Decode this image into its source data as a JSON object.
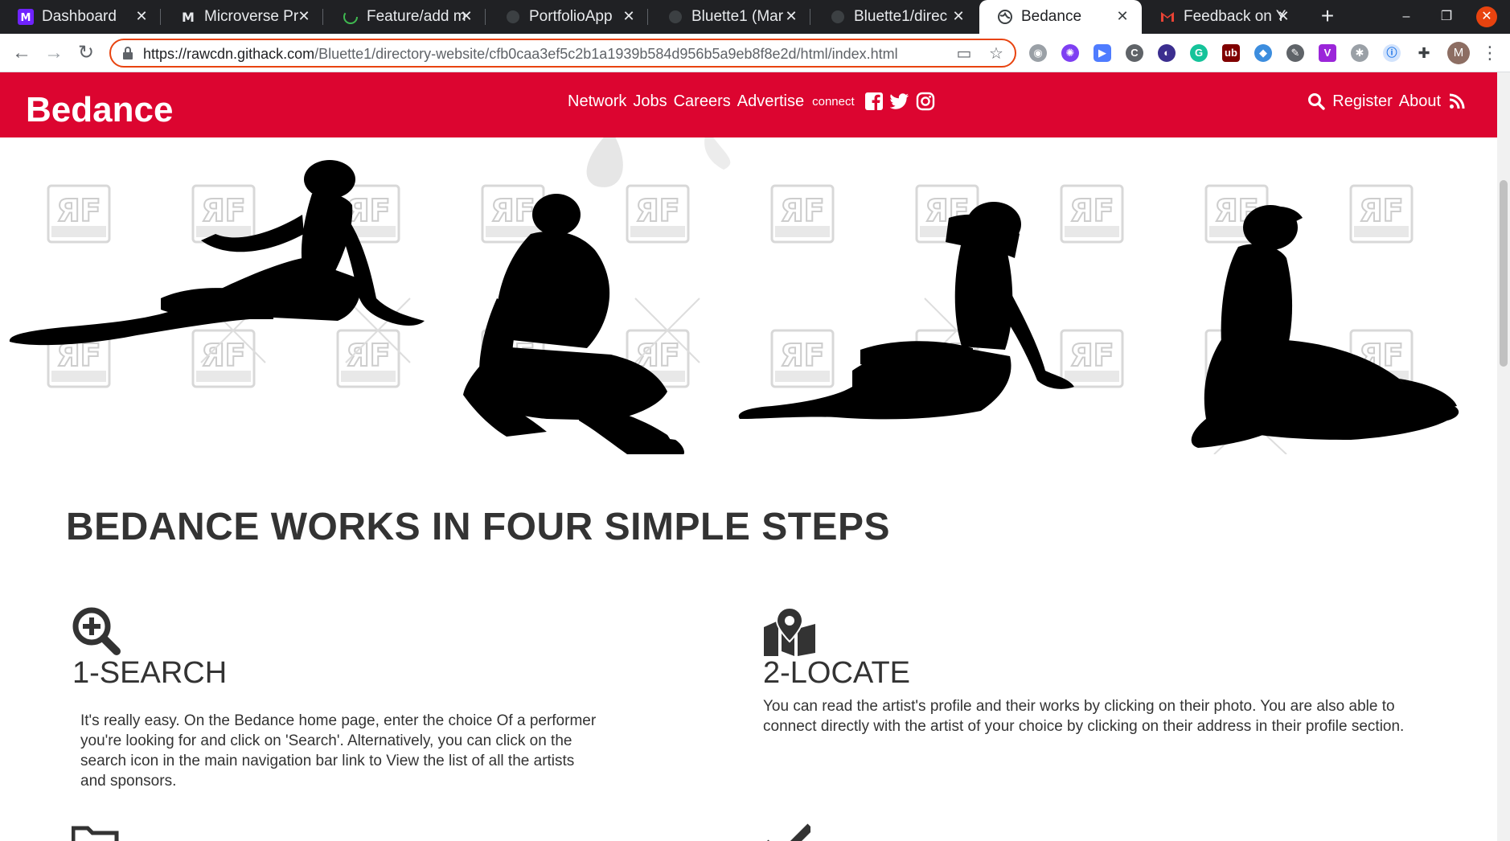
{
  "browser": {
    "tabs": [
      {
        "title": "Dashboard",
        "icon": "microverse-icon"
      },
      {
        "title": "Microverse Pr",
        "icon": "microverse-icon"
      },
      {
        "title": "Feature/add m",
        "icon": "github-icon"
      },
      {
        "title": "PortfolioApp",
        "icon": "globe-icon"
      },
      {
        "title": "Bluette1 (Mar",
        "icon": "github-icon"
      },
      {
        "title": "Bluette1/direc",
        "icon": "github-icon"
      },
      {
        "title": "Bedance",
        "icon": "globe-icon"
      },
      {
        "title": "Feedback on Y",
        "icon": "gmail-icon"
      }
    ],
    "url_host": "https://rawcdn.githack.com",
    "url_path": "/Bluette1/directory-website/cfb0caa3ef5c2b1a1939b584d956b5a9eb8f8e2d/html/index.html",
    "profile_initial": "M",
    "accent_color": "#e8430f"
  },
  "site": {
    "brand": "Bedance",
    "nav_center": [
      "Network",
      "Jobs",
      "Careers",
      "Advertise"
    ],
    "connect_label": "connect",
    "nav_right": [
      "Register",
      "About"
    ],
    "header_color": "#dc0530"
  },
  "main": {
    "heading": "BEDANCE WORKS IN FOUR SIMPLE STEPS",
    "steps": [
      {
        "title": "1-SEARCH",
        "icon": "search-plus-icon",
        "text": "It's really easy. On the Bedance home page, enter the choice Of a performer you're looking for and click on 'Search'. Alternatively, you can click on the search icon in the main navigation bar link to View the list of all the artists and sponsors."
      },
      {
        "title": "2-LOCATE",
        "icon": "map-marker-icon",
        "text": "You can read the artist's profile and their works by clicking on their photo. You are also able to connect directly with the artist of your choice by clicking on their address in their profile section."
      }
    ]
  }
}
